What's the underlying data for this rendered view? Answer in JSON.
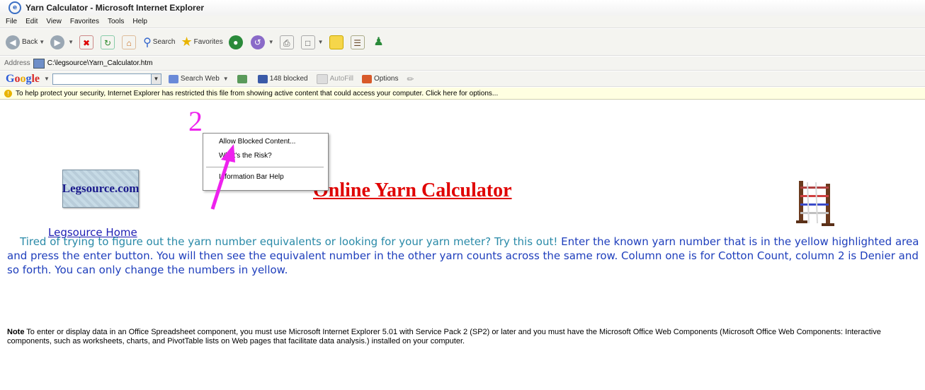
{
  "window": {
    "title": "Yarn Calculator - Microsoft Internet Explorer"
  },
  "menu": [
    "File",
    "Edit",
    "View",
    "Favorites",
    "Tools",
    "Help"
  ],
  "toolbar": {
    "back_label": "Back",
    "search_label": "Search",
    "favorites_label": "Favorites"
  },
  "address": {
    "label": "Address",
    "value": "C:\\legsource\\Yarn_Calculator.htm"
  },
  "google_bar": {
    "logo": "Google",
    "search_web_label": "Search Web",
    "blocked_label": "148 blocked",
    "autofill_label": "AutoFill",
    "options_label": "Options"
  },
  "infobar": {
    "text": "To help protect your security, Internet Explorer has restricted this file from showing active content that could access your computer. Click here for options..."
  },
  "context_menu": {
    "allow": "Allow Blocked Content...",
    "risk": "What's the Risk?",
    "help": "Information Bar Help"
  },
  "annotation": {
    "step_number": "2"
  },
  "page": {
    "logo_text": "Legsource.com",
    "home_link": "Legsource Home",
    "title": "Online Yarn Calculator",
    "intro_a": "Tired of trying to figure out the yarn number equivalents or looking for your yarn meter? Try this out! ",
    "intro_b": "Enter the known yarn number that is in the yellow highlighted area and press the enter button. You will then see the equivalent number in the other yarn counts across the same row. Column one is for Cotton Count, column 2 is Denier and so forth.  You can only change the numbers in yellow.",
    "note_label": "Note",
    "note_text": " To enter or display data in an Office Spreadsheet component, you must use Microsoft Internet Explorer 5.01 with Service Pack 2 (SP2) or later and you must have the Microsoft Office Web Components (Microsoft Office Web Components: Interactive components, such as worksheets, charts, and PivotTable lists on Web pages that facilitate data analysis.) installed on your computer."
  },
  "colors": {
    "title_red": "#e00000",
    "intro_teal": "#2a8aa8",
    "intro_blue": "#1e3ebc",
    "annotation_magenta": "#ee22ee",
    "infobar_bg": "#ffffe1"
  }
}
